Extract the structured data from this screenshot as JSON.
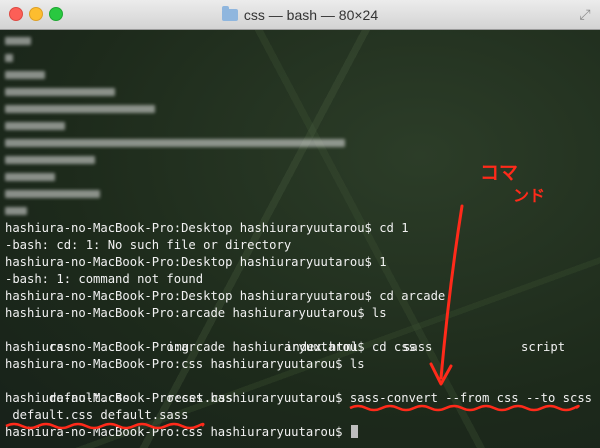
{
  "window": {
    "title": "css — bash — 80×24",
    "controls": [
      "close-icon",
      "minimize-icon",
      "zoom-icon"
    ],
    "title_icon": "folder-icon",
    "resize_icon": "fullscreen-arrows-icon"
  },
  "terminal": {
    "lines": [
      "hashiura-no-MacBook-Pro:Desktop hashiuraryuutarou$ cd 1",
      "-bash: cd: 1: No such file or directory",
      "hashiura-no-MacBook-Pro:Desktop hashiuraryuutarou$ 1",
      "-bash: 1: command not found",
      "hashiura-no-MacBook-Pro:Desktop hashiuraryuutarou$ cd arcade",
      "hashiura-no-MacBook-Pro:arcade hashiuraryuutarou$ ls"
    ],
    "ls_arcade": [
      "css",
      "img",
      "index.html",
      "sass",
      "script"
    ],
    "lines2": [
      "hashiura-no-MacBook-Pro:arcade hashiuraryuutarou$ cd css",
      "hashiura-no-MacBook-Pro:css hashiuraryuutarou$ ls"
    ],
    "ls_css": [
      "default.css",
      "reset.css"
    ],
    "command_prompt": "hashiura-no-MacBook-Pro:css hashiuraryuutarou$ ",
    "command": "sass-convert --from css --to scss",
    "command_wrap": " default.css default.sass",
    "final_prompt": "hashiura-no-MacBook-Pro:css hashiuraryuutarou$ "
  },
  "annotation": {
    "text_line1": "コマ",
    "text_line2": "ンド",
    "color": "#ff2a1a"
  },
  "colors": {
    "text": "#f2f2f2",
    "annotation_red": "#ff2a1a"
  }
}
